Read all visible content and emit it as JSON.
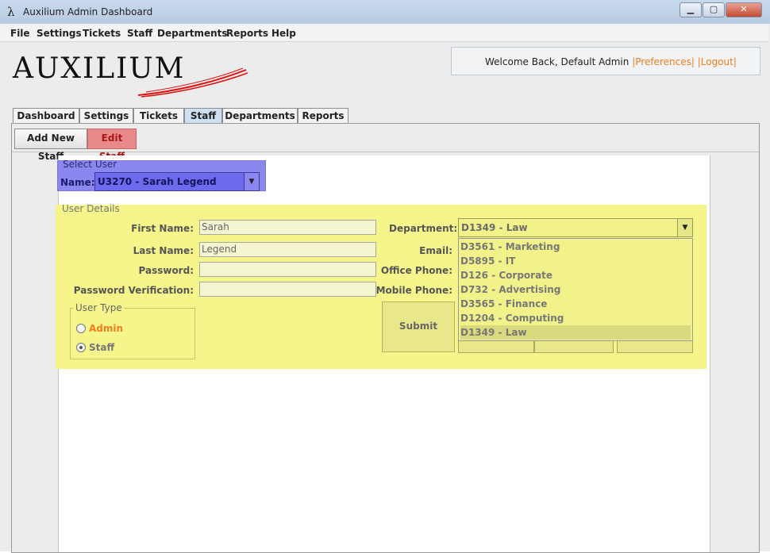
{
  "window": {
    "title": "Auxilium Admin Dashboard",
    "lambda": "λ"
  },
  "menu": [
    "File",
    "Settings",
    "Tickets",
    "Staff",
    "Departments",
    "Reports",
    "Help"
  ],
  "header": {
    "logo": "AUXILIUM",
    "welcome": "Welcome Back, Default Admin",
    "preferences": "|Preferences|",
    "logout": "|Logout|"
  },
  "tabs": [
    "Dashboard",
    "Settings",
    "Tickets",
    "Staff",
    "Departments",
    "Reports"
  ],
  "toolbar": {
    "add_staff": "Add New Staff",
    "edit_staff": "Edit Staff"
  },
  "select_user": {
    "title": "Select User",
    "name_label": "Name:",
    "value": "U3270 - Sarah Legend"
  },
  "details": {
    "title": "User Details",
    "first_name_label": "First Name:",
    "first_name_value": "Sarah",
    "last_name_label": "Last Name:",
    "last_name_value": "Legend",
    "password_label": "Password:",
    "password_verify_label": "Password Verification:",
    "department_label": "Department:",
    "department_value": "D1349 - Law",
    "email_label": "Email:",
    "office_phone_label": "Office Phone:",
    "mobile_phone_label": "Mobile Phone:",
    "user_type_title": "User Type",
    "admin_label": "Admin",
    "staff_label": "Staff",
    "submit_label": "Submit",
    "departments": [
      "D3561 - Marketing",
      "D5895 - IT",
      "D126 - Corporate",
      "D732 - Advertising",
      "D3565 - Finance",
      "D1204 - Computing",
      "D1349 - Law"
    ]
  },
  "colors": {
    "select_highlight": "#8c87ee",
    "details_highlight": "#f5f58c",
    "edit_button": "#e88a8a",
    "accent_orange": "#f07e1b"
  }
}
